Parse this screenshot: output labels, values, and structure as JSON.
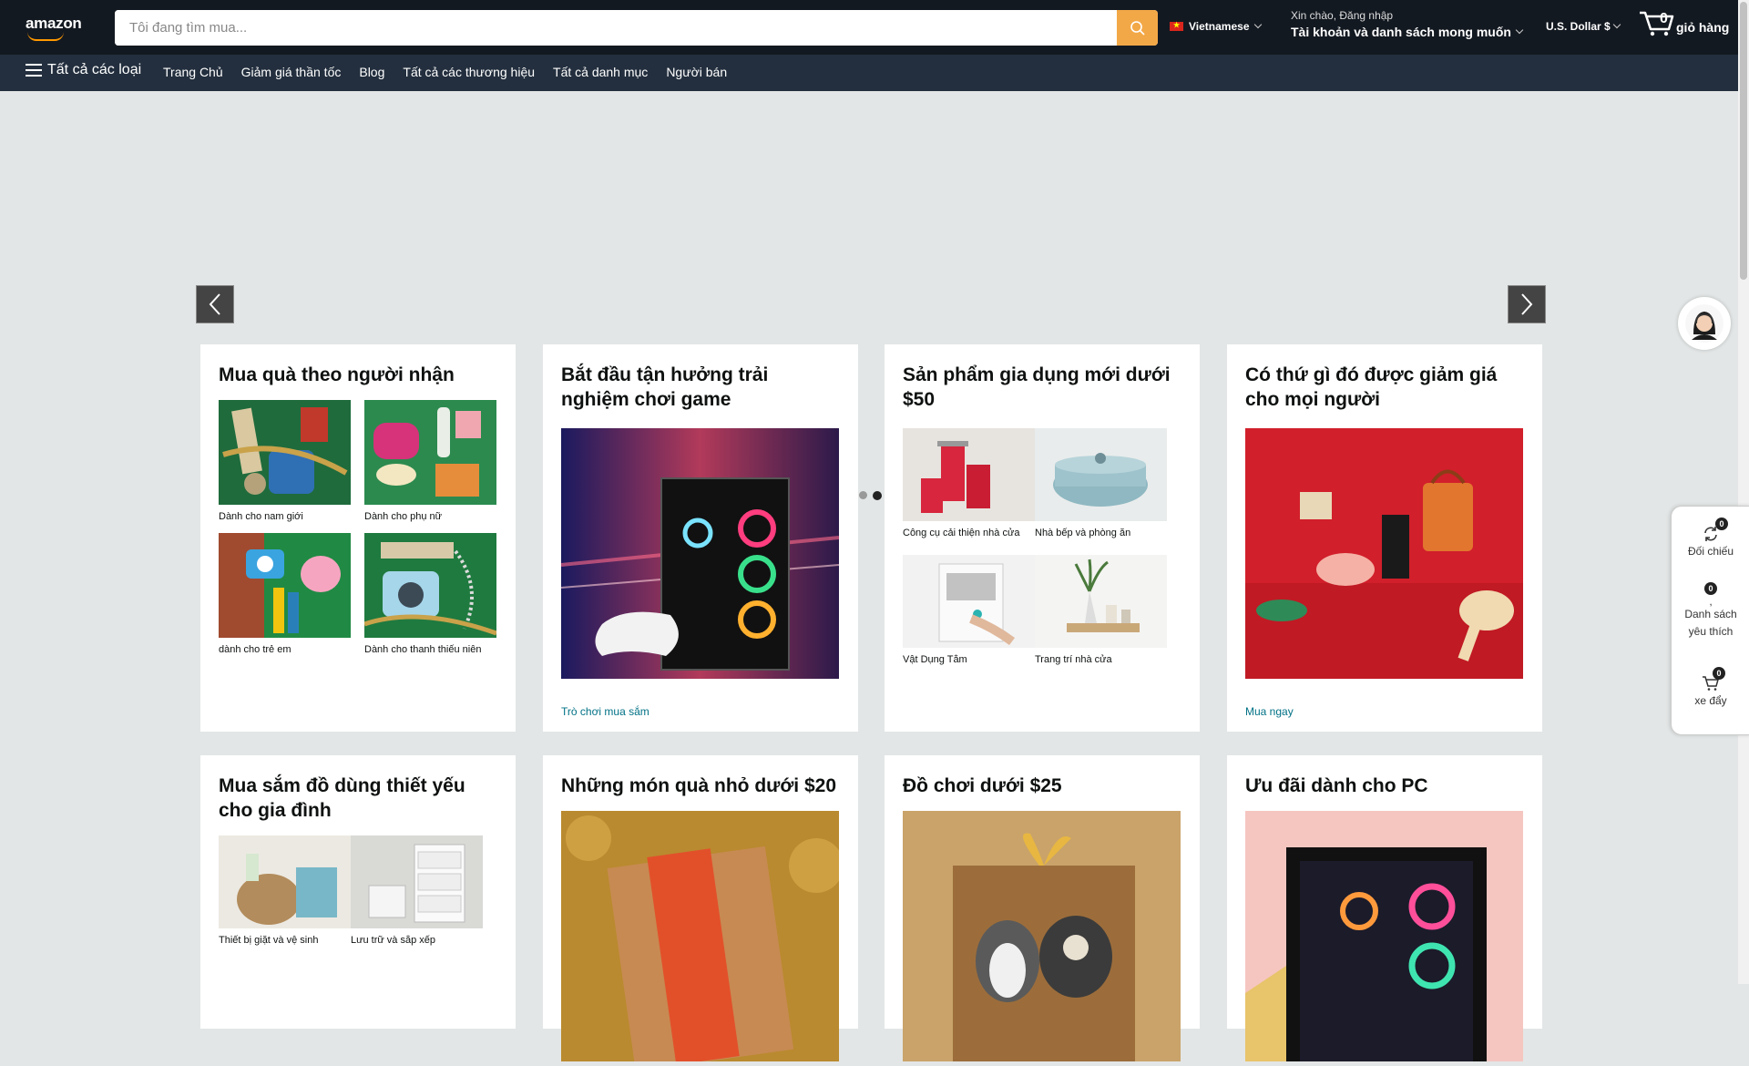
{
  "header": {
    "logo_text": "amazon",
    "search": {
      "placeholder": "Tôi đang tìm mua..."
    },
    "language": "Vietnamese",
    "account": {
      "greeting": "Xin chào, Đăng nhập",
      "label": "Tài khoản và danh sách mong muốn"
    },
    "currency": "U.S. Dollar $",
    "cart": {
      "count": "0",
      "label": "giỏ hàng"
    }
  },
  "nav": {
    "all_label": "Tất cả các loại",
    "links": [
      "Trang Chủ",
      "Giảm giá thần tốc",
      "Blog",
      "Tất cả các thương hiệu",
      "Tất cả danh mục",
      "Người bán"
    ]
  },
  "cards_row1": [
    {
      "title": "Mua quà theo người nhận",
      "tiles": [
        "Dành cho nam giới",
        "Dành cho phụ nữ",
        "dành cho trẻ em",
        "Dành cho thanh thiếu niên"
      ]
    },
    {
      "title": "Bắt đầu tận hưởng trải nghiệm chơi game",
      "link": "Trò chơi mua sắm"
    },
    {
      "title": "Sản phẩm gia dụng mới dưới $50",
      "tiles": [
        "Công cụ cải thiện nhà cửa",
        "Nhà bếp và phòng ăn",
        "Vật Dụng Tắm",
        "Trang trí nhà cửa"
      ]
    },
    {
      "title": "Có thứ gì đó được giảm giá cho mọi người",
      "link": "Mua ngay"
    }
  ],
  "cards_row2": [
    {
      "title": "Mua sắm đồ dùng thiết yếu cho gia đình",
      "tiles": [
        "Thiết bị giặt và vệ sinh",
        "Lưu trữ và sắp xếp"
      ]
    },
    {
      "title": "Những món quà nhỏ dưới $20"
    },
    {
      "title": "Đồ chơi dưới $25"
    },
    {
      "title": "Ưu đãi dành cho PC"
    }
  ],
  "side_panel": {
    "compare": {
      "count": "0",
      "label": "Đối chiếu"
    },
    "wishlist": {
      "count": "0",
      "sep": ",",
      "label": "Danh sách yêu thích"
    },
    "cart": {
      "count": "0",
      "label": "xe đẩy"
    }
  },
  "colors": {
    "header_bg": "#131921",
    "nav_bg": "#232f3e",
    "search_btn": "#f3a847",
    "link": "#007185"
  }
}
